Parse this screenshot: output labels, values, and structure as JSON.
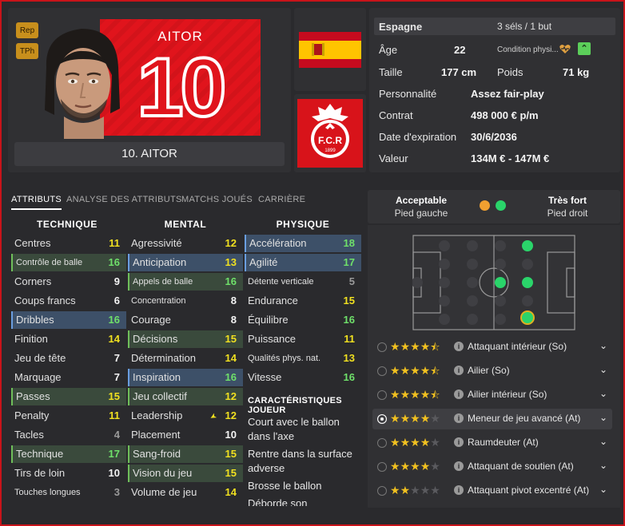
{
  "header": {
    "badges": [
      "Rep",
      "TPh"
    ],
    "shirt_name": "AITOR",
    "shirt_number": "10",
    "player_label": "10. AITOR"
  },
  "info": {
    "nation": "Espagne",
    "caps": "3 séls / 1 but",
    "age_label": "Âge",
    "age": "22",
    "condition_label": "Condition physi...",
    "height_label": "Taille",
    "height": "177 cm",
    "weight_label": "Poids",
    "weight": "71 kg",
    "personality_label": "Personnalité",
    "personality": "Assez fair-play",
    "contract_label": "Contrat",
    "contract": "498 000 € p/m",
    "expiry_label": "Date d'expiration",
    "expiry": "30/6/2036",
    "value_label": "Valeur",
    "value": "134M € - 147M €"
  },
  "tabs": [
    {
      "label": "ATTRIBUTS",
      "active": true
    },
    {
      "label": "ANALYSE DES ATTRIBUTS",
      "active": false
    },
    {
      "label": "MATCHS JOUÉS",
      "active": false
    },
    {
      "label": "CARRIÈRE",
      "active": false
    }
  ],
  "attributes": {
    "technique_title": "TECHNIQUE",
    "mental_title": "MENTAL",
    "physique_title": "PHYSIQUE",
    "technique": [
      {
        "label": "Centres",
        "value": "11",
        "color": "yellow",
        "hl": ""
      },
      {
        "label": "Contrôle de balle",
        "value": "16",
        "color": "green",
        "hl": "green",
        "small": true
      },
      {
        "label": "Corners",
        "value": "9",
        "color": "white",
        "hl": ""
      },
      {
        "label": "Coups francs",
        "value": "6",
        "color": "white",
        "hl": ""
      },
      {
        "label": "Dribbles",
        "value": "16",
        "color": "green",
        "hl": "blue"
      },
      {
        "label": "Finition",
        "value": "14",
        "color": "yellow",
        "hl": ""
      },
      {
        "label": "Jeu de tête",
        "value": "7",
        "color": "white",
        "hl": ""
      },
      {
        "label": "Marquage",
        "value": "7",
        "color": "white",
        "hl": ""
      },
      {
        "label": "Passes",
        "value": "15",
        "color": "yellow",
        "hl": "green"
      },
      {
        "label": "Penalty",
        "value": "11",
        "color": "yellow",
        "hl": ""
      },
      {
        "label": "Tacles",
        "value": "4",
        "color": "grey",
        "hl": ""
      },
      {
        "label": "Technique",
        "value": "17",
        "color": "green",
        "hl": "green"
      },
      {
        "label": "Tirs de loin",
        "value": "10",
        "color": "white",
        "hl": ""
      },
      {
        "label": "Touches longues",
        "value": "3",
        "color": "grey",
        "hl": "",
        "small": true
      }
    ],
    "mental": [
      {
        "label": "Agressivité",
        "value": "12",
        "color": "yellow",
        "hl": ""
      },
      {
        "label": "Anticipation",
        "value": "13",
        "color": "yellow",
        "hl": "blue"
      },
      {
        "label": "Appels de balle",
        "value": "16",
        "color": "green",
        "hl": "green",
        "small": true
      },
      {
        "label": "Concentration",
        "value": "8",
        "color": "white",
        "hl": "",
        "small": true
      },
      {
        "label": "Courage",
        "value": "8",
        "color": "white",
        "hl": ""
      },
      {
        "label": "Décisions",
        "value": "15",
        "color": "yellow",
        "hl": "green"
      },
      {
        "label": "Détermination",
        "value": "14",
        "color": "yellow",
        "hl": ""
      },
      {
        "label": "Inspiration",
        "value": "16",
        "color": "green",
        "hl": "blue"
      },
      {
        "label": "Jeu collectif",
        "value": "12",
        "color": "yellow",
        "hl": "green"
      },
      {
        "label": "Leadership",
        "value": "12",
        "color": "yellow",
        "hl": "",
        "arrow": true
      },
      {
        "label": "Placement",
        "value": "10",
        "color": "white",
        "hl": ""
      },
      {
        "label": "Sang-froid",
        "value": "15",
        "color": "yellow",
        "hl": "green"
      },
      {
        "label": "Vision du jeu",
        "value": "15",
        "color": "yellow",
        "hl": "green"
      },
      {
        "label": "Volume de jeu",
        "value": "14",
        "color": "yellow",
        "hl": ""
      }
    ],
    "physique": [
      {
        "label": "Accélération",
        "value": "18",
        "color": "green",
        "hl": "blue"
      },
      {
        "label": "Agilité",
        "value": "17",
        "color": "green",
        "hl": "blue"
      },
      {
        "label": "Détente verticale",
        "value": "5",
        "color": "grey",
        "hl": "",
        "small": true
      },
      {
        "label": "Endurance",
        "value": "15",
        "color": "yellow",
        "hl": ""
      },
      {
        "label": "Équilibre",
        "value": "16",
        "color": "green",
        "hl": ""
      },
      {
        "label": "Puissance",
        "value": "11",
        "color": "yellow",
        "hl": ""
      },
      {
        "label": "Qualités phys. nat.",
        "value": "13",
        "color": "yellow",
        "hl": "",
        "small": true
      },
      {
        "label": "Vitesse",
        "value": "16",
        "color": "green",
        "hl": ""
      }
    ]
  },
  "traits": {
    "title": "CARACTÉRISTIQUES JOUEUR",
    "items": [
      "Court avec le ballon dans l'axe",
      "Rentre dans la surface adverse",
      "Brosse le ballon",
      "Déborde son"
    ]
  },
  "feet": {
    "left_rating": "Acceptable",
    "left_label": "Pied gauche",
    "right_rating": "Très fort",
    "right_label": "Pied droit",
    "left_color": "#f0a030",
    "right_color": "#2ad46a"
  },
  "roles": [
    {
      "stars": 4.5,
      "name": "Attaquant intérieur (So)",
      "selected": false
    },
    {
      "stars": 4.5,
      "name": "Ailier (So)",
      "selected": false
    },
    {
      "stars": 4.5,
      "name": "Ailier intérieur (So)",
      "selected": false
    },
    {
      "stars": 4,
      "name": "Meneur de jeu avancé (At)",
      "selected": true
    },
    {
      "stars": 4,
      "name": "Raumdeuter (At)",
      "selected": false
    },
    {
      "stars": 4,
      "name": "Attaquant de soutien (At)",
      "selected": false
    },
    {
      "stars": 2,
      "name": "Attaquant pivot excentré (At)",
      "selected": false
    }
  ],
  "colors": {
    "accent_red": "#c8131a",
    "good_green": "#2ad46a",
    "value_yellow": "#f0e020"
  }
}
